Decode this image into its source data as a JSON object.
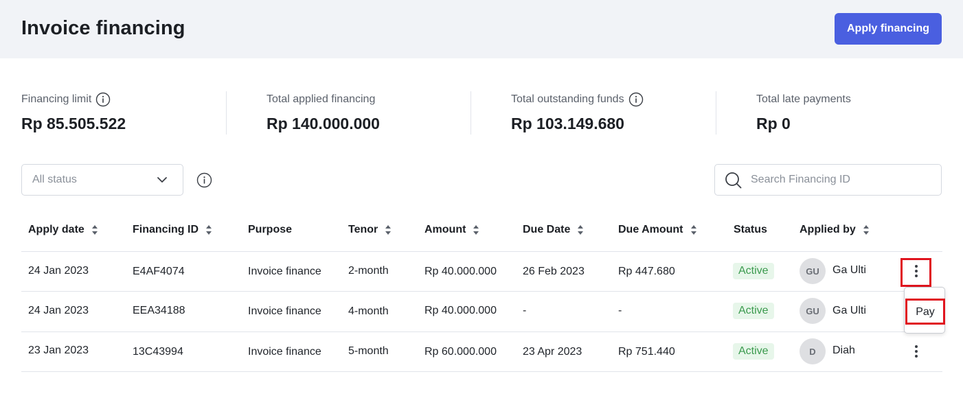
{
  "header": {
    "title": "Invoice financing",
    "apply_label": "Apply financing"
  },
  "stats": [
    {
      "label": "Financing limit",
      "value": "Rp 85.505.522",
      "has_info": true
    },
    {
      "label": "Total applied financing",
      "value": "Rp 140.000.000",
      "has_info": false
    },
    {
      "label": "Total outstanding funds",
      "value": "Rp 103.149.680",
      "has_info": true
    },
    {
      "label": "Total late payments",
      "value": "Rp 0",
      "has_info": false
    }
  ],
  "filters": {
    "status_value": "All status",
    "search_placeholder": "Search Financing ID"
  },
  "table": {
    "columns": [
      {
        "label": "Apply date",
        "sortable": true
      },
      {
        "label": "Financing ID",
        "sortable": true
      },
      {
        "label": "Purpose",
        "sortable": false
      },
      {
        "label": "Tenor",
        "sortable": true
      },
      {
        "label": "Amount",
        "sortable": true
      },
      {
        "label": "Due Date",
        "sortable": true
      },
      {
        "label": "Due Amount",
        "sortable": true
      },
      {
        "label": "Status",
        "sortable": false
      },
      {
        "label": "Applied by",
        "sortable": true
      }
    ],
    "rows": [
      {
        "apply_date": "24 Jan 2023",
        "financing_id": "E4AF4074",
        "purpose": "Invoice finance",
        "tenor": "2-month",
        "amount": "Rp 40.000.000",
        "due_date": "26 Feb 2023",
        "due_amount": "Rp 447.680",
        "status": "Active",
        "initials": "GU",
        "applied_by": "Ga Ulti"
      },
      {
        "apply_date": "24 Jan 2023",
        "financing_id": "EEA34188",
        "purpose": "Invoice finance",
        "tenor": "4-month",
        "amount": "Rp 40.000.000",
        "due_date": "-",
        "due_amount": "-",
        "status": "Active",
        "initials": "GU",
        "applied_by": "Ga Ulti"
      },
      {
        "apply_date": "23 Jan 2023",
        "financing_id": "13C43994",
        "purpose": "Invoice finance",
        "tenor": "5-month",
        "amount": "Rp 60.000.000",
        "due_date": "23 Apr 2023",
        "due_amount": "Rp 751.440",
        "status": "Active",
        "initials": "D",
        "applied_by": "Diah"
      }
    ]
  },
  "row_menu": {
    "pay_label": "Pay"
  },
  "colors": {
    "accent": "#4a5fe0",
    "status_active_bg": "#e7f6ea",
    "status_active_text": "#3a9a4d",
    "highlight": "#e0141e"
  }
}
